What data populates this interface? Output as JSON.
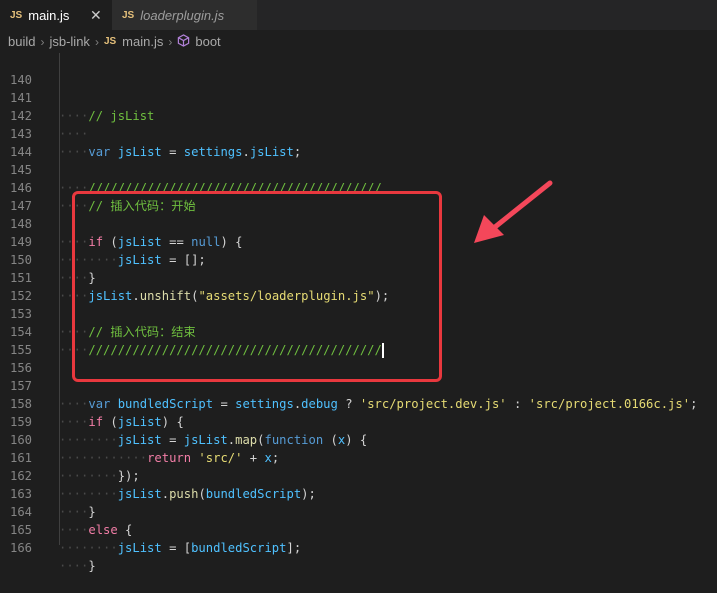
{
  "tabs": [
    {
      "label": "main.js",
      "icon": "JS",
      "active": true,
      "close": "✕"
    },
    {
      "label": "loaderplugin.js",
      "icon": "JS",
      "active": false
    }
  ],
  "breadcrumb": {
    "items": [
      "build",
      "jsb-link",
      "main.js",
      "boot"
    ],
    "file_icon": "JS",
    "symbol_icon": "cube-icon"
  },
  "line_numbers": [
    "140",
    "141",
    "142",
    "143",
    "144",
    "145",
    "146",
    "147",
    "148",
    "149",
    "150",
    "151",
    "152",
    "153",
    "154",
    "155",
    "156",
    "157",
    "158",
    "159",
    "160",
    "161",
    "162",
    "163",
    "164",
    "165",
    "166"
  ],
  "code": {
    "l141": "// jsList",
    "l143": {
      "kw": "var",
      "name": "jsList",
      "eq": " = ",
      "obj": "settings",
      "dot": ".",
      "prop": "jsList",
      "end": ";"
    },
    "l145": "////////////////////////////////////////",
    "l146": "// 插入代码：开始",
    "l148": {
      "kw": "if",
      "open": " (",
      "name": "jsList",
      "op": " == ",
      "val": "null",
      "close": ") {"
    },
    "l149": {
      "name": "jsList",
      "rest": " = [];"
    },
    "l150": "}",
    "l151": {
      "obj": "jsList",
      "dot": ".",
      "fn": "unshift",
      "open": "(",
      "str": "\"assets/loaderplugin.js\"",
      "close": ");"
    },
    "l153": "// 插入代码：结束",
    "l154": "////////////////////////////////////////",
    "l157": {
      "kw": "var",
      "name": "bundledScript",
      "eq": " = ",
      "obj": "settings",
      "dot": ".",
      "prop": "debug",
      "q": " ? ",
      "s1": "'src/project.dev.js'",
      "c": " : ",
      "s2": "'src/project.0166c.js'",
      "end": ";"
    },
    "l158": {
      "kw": "if",
      "open": " (",
      "name": "jsList",
      "close": ") {"
    },
    "l159": {
      "name": "jsList",
      "eq": " = ",
      "obj": "jsList",
      "dot": ".",
      "fn": "map",
      "open": "(",
      "kw": "function",
      "params": " (",
      "param": "x",
      "close": ") {"
    },
    "l160": {
      "kw": "return",
      "str": " 'src/'",
      "op": " + ",
      "name": "x",
      "end": ";"
    },
    "l161": "});",
    "l162": {
      "obj": "jsList",
      "dot": ".",
      "fn": "push",
      "open": "(",
      "name": "bundledScript",
      "close": ");"
    },
    "l163": "}",
    "l164": {
      "kw": "else",
      "rest": " {"
    },
    "l165": {
      "name": "jsList",
      "eq": " = [",
      "arg": "bundledScript",
      "close": "];"
    },
    "l166": "}"
  },
  "colors": {
    "highlight_box": "#e8383e",
    "arrow": "#f4475a",
    "background": "#1e1e1e"
  }
}
